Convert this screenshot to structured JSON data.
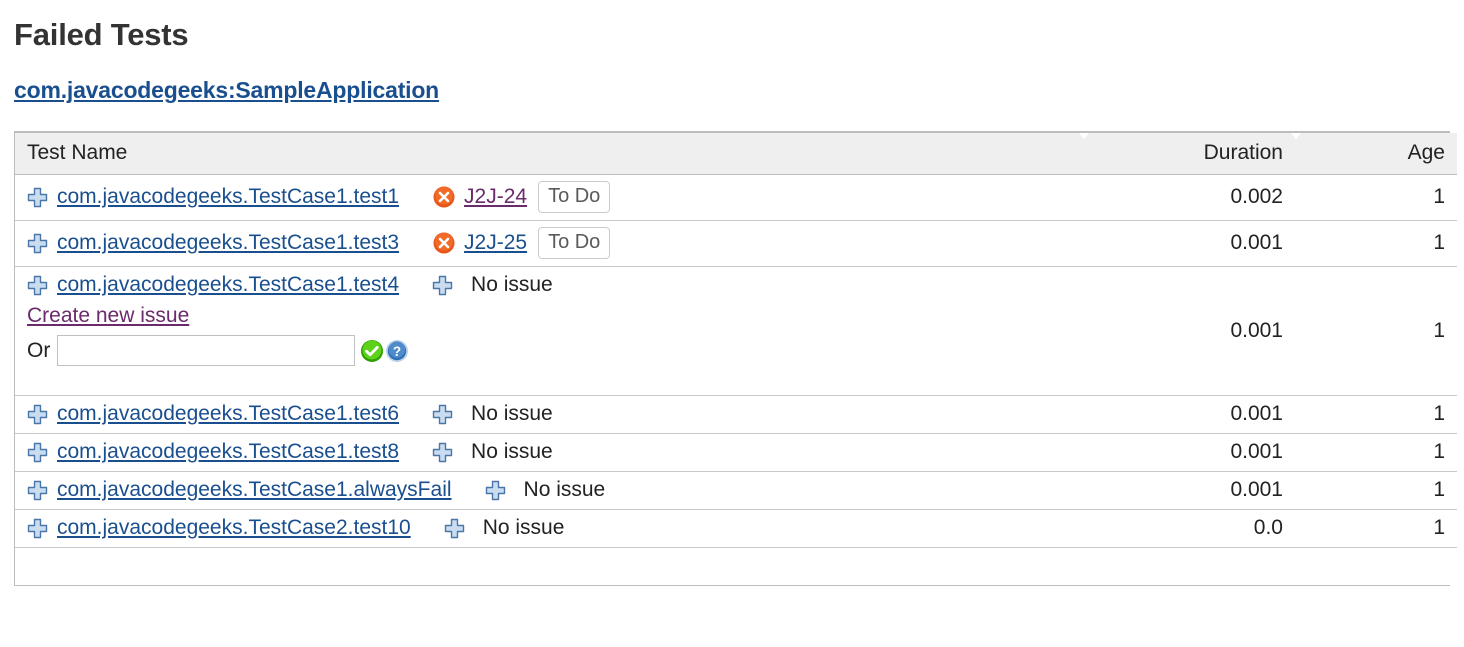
{
  "page": {
    "title": "Failed Tests",
    "project_link": "com.javacodegeeks:SampleApplication"
  },
  "colors": {
    "link": "#1a4f8f",
    "visited_link": "#6b2a6b",
    "error": "#e8561a",
    "success": "#4db800",
    "help": "#2f6fb5",
    "header_bg": "#efefef",
    "border": "#bdbdbd"
  },
  "table": {
    "columns": [
      {
        "key": "name",
        "label": "Test Name",
        "align": "left"
      },
      {
        "key": "duration",
        "label": "Duration",
        "align": "right"
      },
      {
        "key": "age",
        "label": "Age",
        "align": "right"
      }
    ],
    "rows": [
      {
        "expand_icon": "plus-icon",
        "test_name": "com.javacodegeeks.TestCase1.test1",
        "issue": {
          "kind": "linked",
          "status_icon": "error-icon",
          "key": "J2J-24",
          "key_state": "visited",
          "status_label": "To Do"
        },
        "duration": "0.002",
        "age": "1"
      },
      {
        "expand_icon": "plus-icon",
        "test_name": "com.javacodegeeks.TestCase1.test3",
        "issue": {
          "kind": "linked",
          "status_icon": "error-icon",
          "key": "J2J-25",
          "key_state": "unvisited",
          "status_label": "To Do"
        },
        "duration": "0.001",
        "age": "1"
      },
      {
        "expand_icon": "plus-icon",
        "test_name": "com.javacodegeeks.TestCase1.test4",
        "issue": {
          "kind": "none-expanded",
          "icon": "plus-icon",
          "label": "No issue",
          "create_link": "Create new issue",
          "or_label": "Or",
          "input_value": "",
          "input_placeholder": "",
          "confirm_icon": "check-circle-icon",
          "help_icon": "question-circle-icon"
        },
        "duration": "0.001",
        "age": "1"
      },
      {
        "expand_icon": "plus-icon",
        "test_name": "com.javacodegeeks.TestCase1.test6",
        "issue": {
          "kind": "none",
          "icon": "plus-icon",
          "label": "No issue"
        },
        "duration": "0.001",
        "age": "1"
      },
      {
        "expand_icon": "plus-icon",
        "test_name": "com.javacodegeeks.TestCase1.test8",
        "issue": {
          "kind": "none",
          "icon": "plus-icon",
          "label": "No issue"
        },
        "duration": "0.001",
        "age": "1"
      },
      {
        "expand_icon": "plus-icon",
        "test_name": "com.javacodegeeks.TestCase1.alwaysFail",
        "issue": {
          "kind": "none",
          "icon": "plus-icon",
          "label": "No issue"
        },
        "duration": "0.001",
        "age": "1"
      },
      {
        "expand_icon": "plus-icon",
        "test_name": "com.javacodegeeks.TestCase2.test10",
        "issue": {
          "kind": "none",
          "icon": "plus-icon",
          "label": "No issue"
        },
        "duration": "0.0",
        "age": "1"
      }
    ]
  }
}
